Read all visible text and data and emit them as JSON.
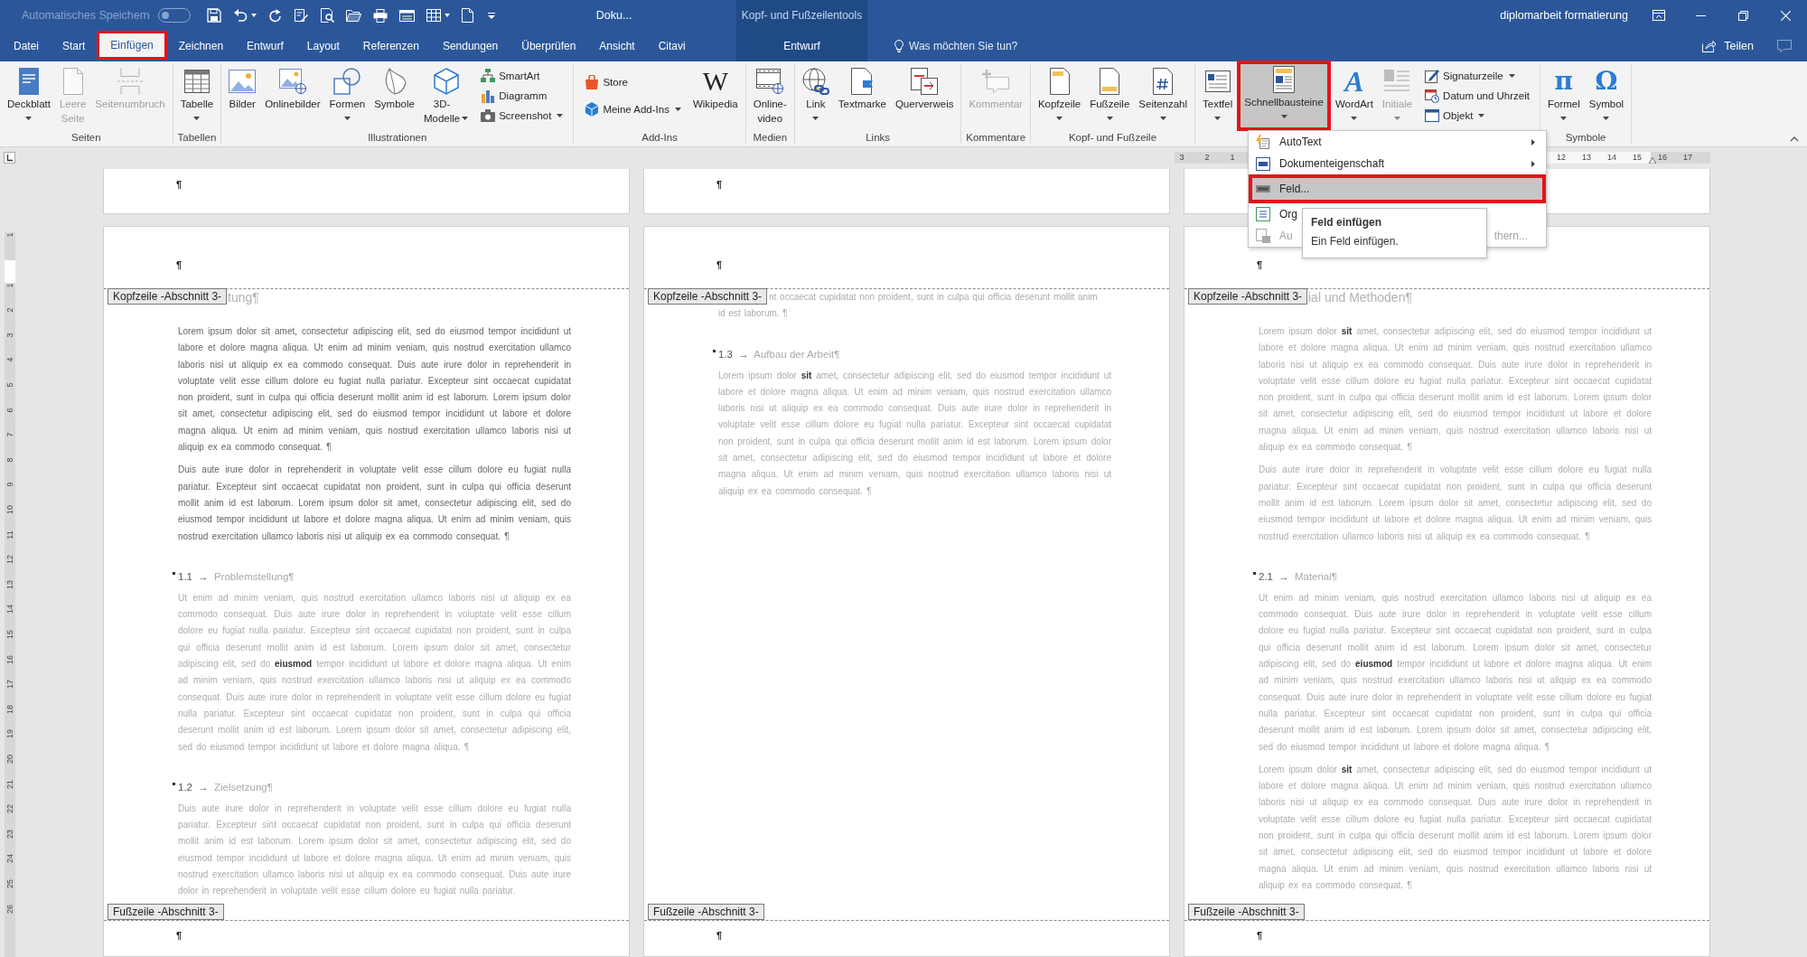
{
  "title_bar": {
    "autosave_label": "Automatisches Speichern",
    "autosave_on": false,
    "document_title": "Doku...",
    "context_title": "Kopf- und Fußzeilentools",
    "account": "diplomarbeit formatierung"
  },
  "tabs": [
    {
      "label": "Datei",
      "selected": false,
      "framed": false
    },
    {
      "label": "Start",
      "selected": false,
      "framed": false
    },
    {
      "label": "Einfügen",
      "selected": true,
      "framed": true
    },
    {
      "label": "Zeichnen",
      "selected": false,
      "framed": false
    },
    {
      "label": "Entwurf",
      "selected": false,
      "framed": false
    },
    {
      "label": "Layout",
      "selected": false,
      "framed": false
    },
    {
      "label": "Referenzen",
      "selected": false,
      "framed": false
    },
    {
      "label": "Sendungen",
      "selected": false,
      "framed": false
    },
    {
      "label": "Überprüfen",
      "selected": false,
      "framed": false
    },
    {
      "label": "Ansicht",
      "selected": false,
      "framed": false
    },
    {
      "label": "Citavi",
      "selected": false,
      "framed": false
    }
  ],
  "context_tabs": [
    {
      "label": "Entwurf",
      "selected": false,
      "framed": false
    }
  ],
  "tell_me": {
    "placeholder": "Was möchten Sie tun?"
  },
  "share": {
    "label": "Teilen"
  },
  "ribbon": {
    "groups": [
      {
        "label": "Seiten",
        "items": [
          {
            "kind": "large",
            "lines": [
              "Deckblatt"
            ],
            "dropdown": true,
            "disabled": false,
            "pressed": false,
            "framed": false
          },
          {
            "kind": "large",
            "lines": [
              "Leere",
              "Seite"
            ],
            "dropdown": false,
            "disabled": true,
            "pressed": false,
            "framed": false
          },
          {
            "kind": "large",
            "lines": [
              "Seitenumbruch"
            ],
            "dropdown": false,
            "disabled": true,
            "pressed": false,
            "framed": false
          }
        ]
      },
      {
        "label": "Tabellen",
        "items": [
          {
            "kind": "large",
            "lines": [
              "Tabelle"
            ],
            "dropdown": true,
            "disabled": false,
            "pressed": false,
            "framed": false
          }
        ]
      },
      {
        "label": "Illustrationen",
        "items": [
          {
            "kind": "large",
            "lines": [
              "Bilder"
            ],
            "dropdown": false,
            "disabled": false,
            "pressed": false,
            "framed": false
          },
          {
            "kind": "large",
            "lines": [
              "Onlinebilder"
            ],
            "dropdown": false,
            "disabled": false,
            "pressed": false,
            "framed": false
          },
          {
            "kind": "large",
            "lines": [
              "Formen"
            ],
            "dropdown": true,
            "disabled": false,
            "pressed": false,
            "framed": false
          },
          {
            "kind": "large",
            "lines": [
              "Symbole"
            ],
            "dropdown": false,
            "disabled": false,
            "pressed": false,
            "framed": false
          },
          {
            "kind": "large",
            "lines": [
              "3D-",
              "Modelle"
            ],
            "dropdown": true,
            "disabled": false,
            "pressed": false,
            "framed": false
          },
          {
            "kind": "small",
            "lines": [
              "SmartArt"
            ],
            "dropdown": false,
            "disabled": false,
            "pressed": false,
            "framed": false
          },
          {
            "kind": "small",
            "lines": [
              "Diagramm"
            ],
            "dropdown": false,
            "disabled": false,
            "pressed": false,
            "framed": false
          },
          {
            "kind": "small",
            "lines": [
              "Screenshot"
            ],
            "dropdown": true,
            "disabled": false,
            "pressed": false,
            "framed": false
          }
        ]
      },
      {
        "label": "Add-Ins",
        "items": [
          {
            "kind": "small",
            "lines": [
              "Store"
            ],
            "dropdown": false,
            "disabled": false,
            "pressed": false,
            "framed": false
          },
          {
            "kind": "small",
            "lines": [
              "Meine Add-Ins"
            ],
            "dropdown": true,
            "disabled": false,
            "pressed": false,
            "framed": false
          },
          {
            "kind": "large",
            "lines": [
              "Wikipedia"
            ],
            "glyph": "W",
            "dropdown": false,
            "disabled": false,
            "pressed": false,
            "framed": false
          }
        ]
      },
      {
        "label": "Medien",
        "items": [
          {
            "kind": "large",
            "lines": [
              "Online-",
              "video"
            ],
            "dropdown": false,
            "disabled": false,
            "pressed": false,
            "framed": false
          }
        ]
      },
      {
        "label": "Links",
        "items": [
          {
            "kind": "large",
            "lines": [
              "Link"
            ],
            "dropdown": true,
            "disabled": false,
            "pressed": false,
            "framed": false
          },
          {
            "kind": "large",
            "lines": [
              "Textmarke"
            ],
            "dropdown": false,
            "disabled": false,
            "pressed": false,
            "framed": false
          },
          {
            "kind": "large",
            "lines": [
              "Querverweis"
            ],
            "dropdown": false,
            "disabled": false,
            "pressed": false,
            "framed": false
          }
        ]
      },
      {
        "label": "Kommentare",
        "items": [
          {
            "kind": "large",
            "lines": [
              "Kommentar"
            ],
            "dropdown": false,
            "disabled": true,
            "pressed": false,
            "framed": false
          }
        ]
      },
      {
        "label": "Kopf- und Fußzeile",
        "items": [
          {
            "kind": "large",
            "lines": [
              "Kopfzeile"
            ],
            "dropdown": true,
            "disabled": false,
            "pressed": false,
            "framed": false
          },
          {
            "kind": "large",
            "lines": [
              "Fußzeile"
            ],
            "dropdown": true,
            "disabled": false,
            "pressed": false,
            "framed": false
          },
          {
            "kind": "large",
            "lines": [
              "Seitenzahl"
            ],
            "dropdown": true,
            "disabled": false,
            "pressed": false,
            "framed": false
          }
        ]
      },
      {
        "items": [
          {
            "kind": "large",
            "lines": [
              "Textfel"
            ],
            "dropdown": true,
            "disabled": false,
            "pressed": false,
            "framed": false
          },
          {
            "kind": "large",
            "lines": [
              "Schnellbausteine"
            ],
            "dropdown": true,
            "disabled": false,
            "pressed": true,
            "framed": true
          },
          {
            "kind": "large",
            "lines": [
              "WordArt"
            ],
            "glyph": "A",
            "dropdown": true,
            "disabled": false,
            "pressed": false,
            "framed": false
          },
          {
            "kind": "large",
            "lines": [
              "Initiale"
            ],
            "dropdown": true,
            "disabled": true,
            "pressed": false,
            "framed": false
          },
          {
            "kind": "small",
            "lines": [
              "Signaturzeile"
            ],
            "dropdown": true,
            "disabled": false,
            "pressed": false,
            "framed": false
          },
          {
            "kind": "small",
            "lines": [
              "Datum und Uhrzeit"
            ],
            "dropdown": false,
            "disabled": false,
            "pressed": false,
            "framed": false
          },
          {
            "kind": "small",
            "lines": [
              "Objekt"
            ],
            "dropdown": true,
            "disabled": false,
            "pressed": false,
            "framed": false
          }
        ]
      },
      {
        "label": "Symbole",
        "items": [
          {
            "kind": "large",
            "lines": [
              "Formel"
            ],
            "glyph": "π",
            "dropdown": true,
            "disabled": false,
            "pressed": false,
            "framed": false
          },
          {
            "kind": "large",
            "lines": [
              "Symbol"
            ],
            "glyph": "Ω",
            "dropdown": true,
            "disabled": false,
            "pressed": false,
            "framed": false
          }
        ]
      }
    ]
  },
  "quick_parts_menu": {
    "items": [
      {
        "label": "AutoText",
        "submenu": true,
        "highlighted": false,
        "framed": false,
        "disabled": false
      },
      {
        "label": "Dokumenteigenschaft",
        "submenu": true,
        "highlighted": false,
        "framed": false,
        "disabled": false
      },
      {
        "label": "Feld...",
        "submenu": false,
        "highlighted": true,
        "framed": true,
        "disabled": false
      },
      {
        "label": "Org",
        "submenu": false,
        "highlighted": false,
        "framed": false,
        "disabled": false
      },
      {
        "label": "Au",
        "label_end": "thern...",
        "submenu": false,
        "highlighted": false,
        "framed": false,
        "disabled": true
      }
    ]
  },
  "tooltip": {
    "title": "Feld einfügen",
    "text": "Ein Feld einfügen."
  },
  "rulers": {
    "horizontal": {
      "left_marks": [
        "3",
        "2",
        "1"
      ],
      "right_marks": [
        "12",
        "13",
        "14",
        "15",
        "16",
        "17"
      ]
    },
    "vertical": {
      "top_marks": [
        "1"
      ],
      "marks": [
        "1",
        "2",
        "3",
        "4",
        "5",
        "6",
        "7",
        "8",
        "9",
        "10",
        "11",
        "12",
        "13",
        "14",
        "15",
        "16",
        "17",
        "18",
        "19",
        "20",
        "21",
        "22",
        "23",
        "24",
        "25",
        "26"
      ]
    }
  },
  "pages": [
    {
      "prev_page_mark": "¶",
      "header_mark": "¶",
      "header_label": "Kopfzeile -Abschnitt 3-",
      "footer_label": "Fußzeile -Abschnitt 3-",
      "footer_mark": "¶",
      "blocks": [
        {
          "kind": "chapter",
          "dimmed": true,
          "text": "tung¶"
        },
        {
          "kind": "paragraph",
          "dimmed": false,
          "text": "Lorem ipsum dolor sit amet, consectetur adipiscing elit, sed do eiusmod tempor incididunt ut labore et dolore magna aliqua. Ut enim ad minim veniam, quis nostrud exercitation ullamco laboris nisi ut aliquip ex ea commodo consequat. Duis aute irure dolor in reprehenderit in voluptate velit esse cillum dolore eu fugiat nulla pariatur. Excepteur sint occaecat cupidatat non proident, sunt in culpa qui officia deserunt mollit anim id est laborum. Lorem ipsum dolor sit amet, consectetur adipiscing elit, sed do eiusmod tempor incididunt ut labore et dolore magna aliqua. Ut enim ad minim veniam, quis nostrud exercitation ullamco laboris nisi ut aliquip ex ea commodo consequat. ¶"
        },
        {
          "kind": "paragraph",
          "dimmed": false,
          "text": "Duis aute irure dolor in reprehenderit in voluptate velit esse cillum dolore eu fugiat nulla pariatur. Excepteur sint occaecat cupidatat non proident, sunt in culpa qui officia deserunt mollit anim id est laborum. Lorem ipsum dolor sit amet, consectetur adipiscing elit, sed do eiusmod tempor incididunt ut labore et dolore magna aliqua. Ut enim ad minim veniam, quis nostrud exercitation ullamco laboris nisi ut aliquip ex ea commodo consequat. ¶"
        },
        {
          "kind": "section",
          "dimmed": true,
          "number": "1.1",
          "arrow": "→",
          "title": "Problemstellung¶"
        },
        {
          "kind": "paragraph",
          "dimmed": true,
          "text": "Ut enim ad minim veniam, quis nostrud exercitation ullamco laboris nisi ut aliquip ex ea commodo consequat. Duis aute irure dolor in reprehenderit in voluptate velit esse cillum dolore eu fugiat nulla pariatur. Excepteur sint occaecat cupidatat non proident, sunt in culpa qui officia deserunt mollit anim id est laborum. Lorem ipsum dolor sit amet, consectetur adipiscing elit, sed do **eiusmod** tempor incididunt ut labore et dolore magna aliqua. Ut enim ad minim veniam, quis nostrud exercitation ullamco laboris nisi ut aliquip ex ea commodo consequat. Duis aute irure dolor in reprehenderit in voluptate velit esse cillum dolore eu fugiat nulla pariatur. Excepteur sint occaecat cupidatat non proident, sunt in culpa qui officia deserunt mollit anim id est laborum. Lorem ipsum dolor sit amet, consectetur adipiscing elit, sed do eiusmod tempor incididunt ut labore et dolore magna aliqua. ¶"
        },
        {
          "kind": "section",
          "dimmed": true,
          "number": "1.2",
          "arrow": "→",
          "title": "Zielsetzung¶"
        },
        {
          "kind": "paragraph",
          "dimmed": true,
          "text": "Duis aute irure dolor in reprehenderit in voluptate velit esse cillum dolore eu fugiat nulla pariatur. Excepteur sint occaecat cupidatat non proident, sunt in culpa qui officia deserunt mollit anim id est laborum. Lorem ipsum dolor sit amet, consectetur adipiscing elit, sed do eiusmod tempor incididunt ut labore et dolore magna aliqua. Ut enim ad minim veniam, quis nostrud exercitation ullamco laboris nisi ut aliquip ex ea commodo consequat. Duis aute irure dolor in reprehenderit in voluptate velit esse cillum dolore eu fugiat nulla pariatur."
        }
      ]
    },
    {
      "prev_page_mark": "¶",
      "header_mark": "¶",
      "header_label": "Kopfzeile -Abschnitt 3-",
      "footer_label": "Fußzeile -Abschnitt 3-",
      "footer_mark": "¶",
      "blocks": [
        {
          "kind": "continuation",
          "dimmed": true,
          "lines": [
            "nt occaecat cupidatat non proident, sunt in culpa qui officia deserunt mollit anim",
            "id est laborum. ¶"
          ]
        },
        {
          "kind": "section",
          "dimmed": true,
          "number": "1.3",
          "arrow": "→",
          "title": "Aufbau der Arbeit¶"
        },
        {
          "kind": "paragraph",
          "dimmed": true,
          "text": "Lorem ipsum dolor **sit** amet, consectetur adipiscing elit, sed do eiusmod tempor incididunt ut labore et dolore magna aliqua. Ut enim ad minim veniam, quis nostrud exercitation ullamco laboris nisi ut aliquip ex ea commodo consequat. Duis aute irure dolor in reprehenderit in voluptate velit esse cillum dolore eu fugiat nulla pariatur. Excepteur sint occaecat cupidatat non proident, sunt in culpa qui officia deserunt mollit anim id est laborum. Lorem ipsum dolor sit amet, consectetur adipiscing elit, sed do eiusmod tempor incididunt ut labore et dolore magna aliqua. Ut enim ad minim veniam, quis nostrud exercitation ullamco laboris nisi ut aliquip ex ea commodo consequat. ¶"
        }
      ]
    },
    {
      "header_mark": "¶",
      "header_label": "Kopfzeile -Abschnitt 3-",
      "footer_label": "Fußzeile -Abschnitt 3-",
      "footer_mark": "¶",
      "blocks": [
        {
          "kind": "chapter",
          "dimmed": true,
          "text": "ial und Methoden¶"
        },
        {
          "kind": "paragraph",
          "dimmed": true,
          "text": "Lorem ipsum dolor **sit** amet, consectetur adipiscing elit, sed do eiusmod tempor incididunt ut labore et dolore magna aliqua. Ut enim ad minim veniam, quis nostrud exercitation ullamco laboris nisi ut aliquip ex ea commodo consequat. Duis aute irure dolor in reprehenderit in voluptate velit esse cillum dolore eu fugiat nulla pariatur. Excepteur sint occaecat cupidatat non proident, sunt in culpa qui officia deserunt mollit anim id est laborum. Lorem ipsum dolor sit amet, consectetur adipiscing elit, sed do eiusmod tempor incididunt ut labore et dolore magna aliqua. Ut enim ad minim veniam, quis nostrud exercitation ullamco laboris nisi ut aliquip ex ea commodo consequat. ¶"
        },
        {
          "kind": "paragraph",
          "dimmed": true,
          "text": "Duis aute irure dolor in reprehenderit in voluptate velit esse cillum dolore eu fugiat nulla pariatur. Excepteur sint occaecat cupidatat non proident, sunt in culpa qui officia deserunt mollit anim id est laborum. Lorem ipsum dolor sit amet, consectetur adipiscing elit, sed do eiusmod tempor incididunt ut labore et dolore magna aliqua. Ut enim ad minim veniam, quis nostrud exercitation ullamco laboris nisi ut aliquip ex ea commodo consequat. ¶"
        },
        {
          "kind": "section",
          "dimmed": true,
          "number": "2.1",
          "arrow": "→",
          "title": "Material¶"
        },
        {
          "kind": "paragraph",
          "dimmed": true,
          "text": "Ut enim ad minim veniam, quis nostrud exercitation ullamco laboris nisi ut aliquip ex ea commodo consequat. Duis aute irure dolor in reprehenderit in voluptate velit esse cillum dolore eu fugiat nulla pariatur. Excepteur sint occaecat cupidatat non proident, sunt in culpa qui officia deserunt mollit anim id est laborum. Lorem ipsum dolor sit amet, consectetur adipiscing elit, sed do **eiusmod** tempor incididunt ut labore et dolore magna aliqua. Ut enim ad minim veniam, quis nostrud exercitation ullamco laboris nisi ut aliquip ex ea commodo consequat. Duis aute irure dolor in reprehenderit in voluptate velit esse cillum dolore eu fugiat nulla pariatur. Excepteur sint occaecat cupidatat non proident, sunt in culpa qui officia deserunt mollit anim id est laborum. Lorem ipsum dolor sit amet, consectetur adipiscing elit, sed do eiusmod tempor incididunt ut labore et dolore magna aliqua. ¶"
        },
        {
          "kind": "paragraph",
          "dimmed": true,
          "text": "Lorem ipsum dolor **sit** amet, consectetur adipiscing elit, sed do eiusmod tempor incididunt ut labore et dolore magna aliqua. Ut enim ad minim veniam, quis nostrud exercitation ullamco laboris nisi ut aliquip ex ea commodo consequat. Duis aute irure dolor in reprehenderit in voluptate velit esse cillum dolore eu fugiat nulla pariatur. Excepteur sint occaecat cupidatat non proident, sunt in culpa qui officia deserunt mollit anim id est laborum. Lorem ipsum dolor sit amet, consectetur adipiscing elit, sed do eiusmod tempor incididunt ut labore et dolore magna aliqua. Ut enim ad minim veniam, quis nostrud exercitation ullamco laboris nisi ut aliquip ex ea commodo consequat. ¶"
        }
      ]
    }
  ]
}
